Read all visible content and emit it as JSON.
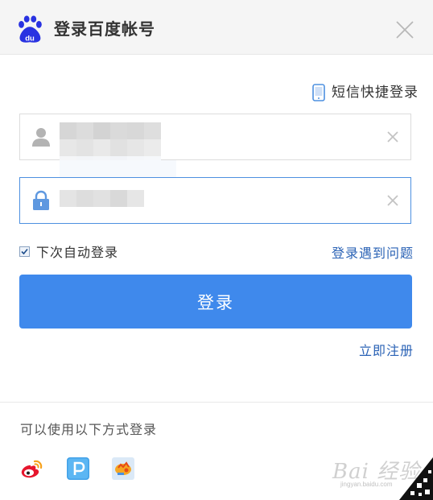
{
  "header": {
    "title": "登录百度帐号",
    "logo_text": "du"
  },
  "sms_login": {
    "label": "短信快捷登录"
  },
  "form": {
    "username_value": "",
    "password_value": "",
    "remember_label": "下次自动登录",
    "remember_checked": true,
    "problem_link": "登录遇到问题",
    "submit_label": "登录",
    "register_link": "立即注册"
  },
  "other_login": {
    "hint": "可以使用以下方式登录",
    "providers": [
      "weibo",
      "baidu-pass",
      "other"
    ]
  },
  "watermark": {
    "text": "Bai 经验",
    "url": "jingyan.baidu.com"
  },
  "colors": {
    "accent": "#3f89ec",
    "link": "#2a62b5",
    "titlebar_bg": "#f5f5f5",
    "active_border": "#4d90e0"
  }
}
